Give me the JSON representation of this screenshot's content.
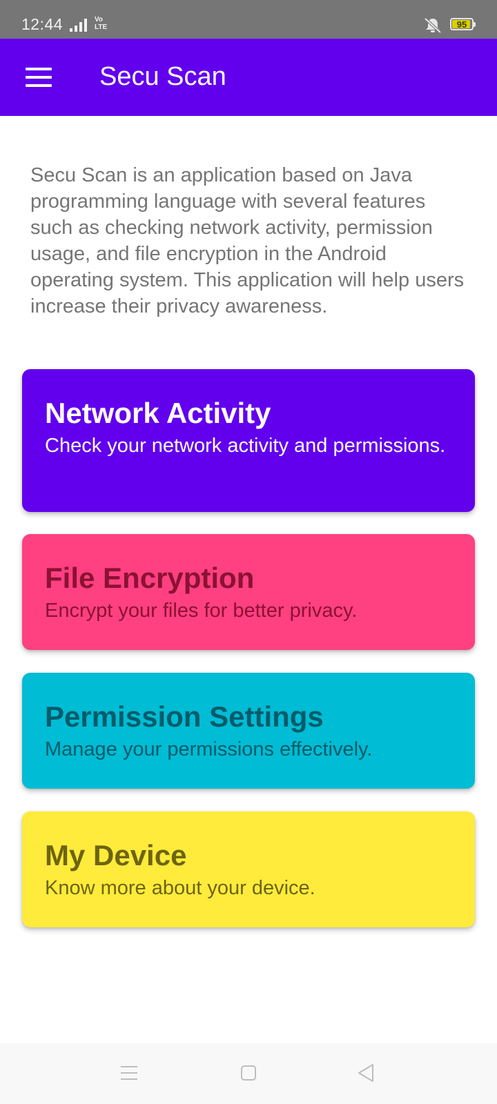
{
  "status_bar": {
    "time": "12:44",
    "volte_line1": "Vo",
    "volte_line2": "LTE",
    "battery": "95",
    "icons": [
      "signal-icon",
      "volte-icon",
      "mute-icon",
      "battery-icon"
    ]
  },
  "app_bar": {
    "title": "Secu Scan",
    "menu_icon": "hamburger-menu-icon",
    "background": "#6200ee"
  },
  "description": "Secu Scan is an application based on Java programming language with several features such as checking network activity, permission usage, and file encryption in the Android operating system. This application will help users increase their privacy awareness.",
  "cards": [
    {
      "title": "Network Activity",
      "subtitle": "Check your network activity and permissions.",
      "color": "#6200ee"
    },
    {
      "title": "File Encryption",
      "subtitle": "Encrypt your files for better privacy.",
      "color": "#ff4081"
    },
    {
      "title": "Permission Settings",
      "subtitle": "Manage your permissions effectively.",
      "color": "#00bcd4"
    },
    {
      "title": "My Device",
      "subtitle": "Know more about your device.",
      "color": "#ffeb3b"
    }
  ],
  "nav_bar": {
    "icons": [
      "recent-apps-icon",
      "home-icon",
      "back-icon"
    ]
  }
}
